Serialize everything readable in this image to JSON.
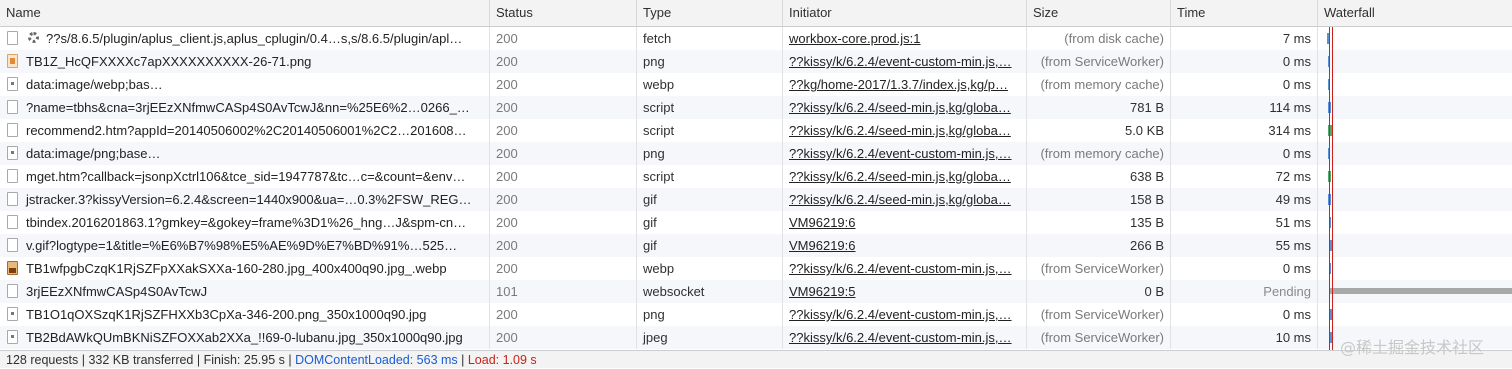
{
  "columns": {
    "name": "Name",
    "status": "Status",
    "type": "Type",
    "initiator": "Initiator",
    "size": "Size",
    "time": "Time",
    "waterfall": "Waterfall"
  },
  "rows": [
    {
      "name": "??s/8.6.5/plugin/aplus_client.js,aplus_cplugin/0.4…s,s/8.6.5/plugin/apl…",
      "status": "200",
      "type": "fetch",
      "initiator": "workbox-core.prod.js:1",
      "size": "(from disk cache)",
      "time": "7 ms",
      "icon": "file-icon",
      "gear": true
    },
    {
      "name": "TB1Z_HcQFXXXXc7apXXXXXXXXXX-26-71.png",
      "status": "200",
      "type": "png",
      "initiator": "??kissy/k/6.2.4/event-custom-min.js,…",
      "size": "(from ServiceWorker)",
      "time": "0 ms",
      "icon": "image-thumb-icon"
    },
    {
      "name": "data:image/webp;bas…",
      "status": "200",
      "type": "webp",
      "initiator": "??kg/home-2017/1.3.7/index.js,kg/p…",
      "size": "(from memory cache)",
      "time": "0 ms",
      "icon": "image-file-icon"
    },
    {
      "name": "?name=tbhs&cna=3rjEEzXNfmwCASp4S0AvTcwJ&nn=%25E6%2…0266_…",
      "status": "200",
      "type": "script",
      "initiator": "??kissy/k/6.2.4/seed-min.js,kg/globa…",
      "size": "781 B",
      "time": "114 ms",
      "icon": "file-icon"
    },
    {
      "name": "recommend2.htm?appId=20140506002%2C20140506001%2C2…201608…",
      "status": "200",
      "type": "script",
      "initiator": "??kissy/k/6.2.4/seed-min.js,kg/globa…",
      "size": "5.0 KB",
      "time": "314 ms",
      "icon": "file-icon"
    },
    {
      "name": "data:image/png;base…",
      "status": "200",
      "type": "png",
      "initiator": "??kissy/k/6.2.4/event-custom-min.js,…",
      "size": "(from memory cache)",
      "time": "0 ms",
      "icon": "image-file-icon"
    },
    {
      "name": "mget.htm?callback=jsonpXctrl106&tce_sid=1947787&tc…c=&count=&env…",
      "status": "200",
      "type": "script",
      "initiator": "??kissy/k/6.2.4/seed-min.js,kg/globa…",
      "size": "638 B",
      "time": "72 ms",
      "icon": "file-icon"
    },
    {
      "name": "jstracker.3?kissyVersion=6.2.4&screen=1440x900&ua=…0.3%2FSW_REG…",
      "status": "200",
      "type": "gif",
      "initiator": "??kissy/k/6.2.4/seed-min.js,kg/globa…",
      "size": "158 B",
      "time": "49 ms",
      "icon": "file-icon"
    },
    {
      "name": "tbindex.2016201863.1?gmkey=&gokey=frame%3D1%26_hng…J&spm-cn…",
      "status": "200",
      "type": "gif",
      "initiator": "VM96219:6",
      "size": "135 B",
      "time": "51 ms",
      "icon": "file-icon"
    },
    {
      "name": "v.gif?logtype=1&title=%E6%B7%98%E5%AE%9D%E7%BD%91%…525…",
      "status": "200",
      "type": "gif",
      "initiator": "VM96219:6",
      "size": "266 B",
      "time": "55 ms",
      "icon": "file-icon"
    },
    {
      "name": "TB1wfpgbCzqK1RjSZFpXXakSXXa-160-280.jpg_400x400q90.jpg_.webp",
      "status": "200",
      "type": "webp",
      "initiator": "??kissy/k/6.2.4/event-custom-min.js,…",
      "size": "(from ServiceWorker)",
      "time": "0 ms",
      "icon": "photo-thumb-icon"
    },
    {
      "name": "3rjEEzXNfmwCASp4S0AvTcwJ",
      "status": "101",
      "type": "websocket",
      "initiator": "VM96219:5",
      "size": "0 B",
      "time": "Pending",
      "icon": "file-icon"
    },
    {
      "name": "TB1O1qOXSzqK1RjSZFHXXb3CpXa-346-200.png_350x1000q90.jpg",
      "status": "200",
      "type": "png",
      "initiator": "??kissy/k/6.2.4/event-custom-min.js,…",
      "size": "(from ServiceWorker)",
      "time": "0 ms",
      "icon": "image-file-icon"
    },
    {
      "name": "TB2BdAWkQUmBKNiSZFOXXab2XXa_!!69-0-lubanu.jpg_350x1000q90.jpg",
      "status": "200",
      "type": "jpeg",
      "initiator": "??kissy/k/6.2.4/event-custom-min.js,…",
      "size": "(from ServiceWorker)",
      "time": "10 ms",
      "icon": "image-file-icon"
    }
  ],
  "footer": {
    "summary": "128 requests | 332 KB transferred | Finish: 25.95 s | ",
    "dom_content_loaded": "DOMContentLoaded: 563 ms",
    "separator": " | ",
    "load": "Load: 1.09 s"
  },
  "watermark": "@稀土掘金技术社区",
  "colors": {
    "dom_content_loaded_line": "#1a5bd6",
    "load_line": "#c8211b",
    "waterfall_bar_blue": "#5b8fd9",
    "waterfall_bar_green": "#56a86b",
    "waterfall_bar_pending": "#a8a8a8"
  }
}
